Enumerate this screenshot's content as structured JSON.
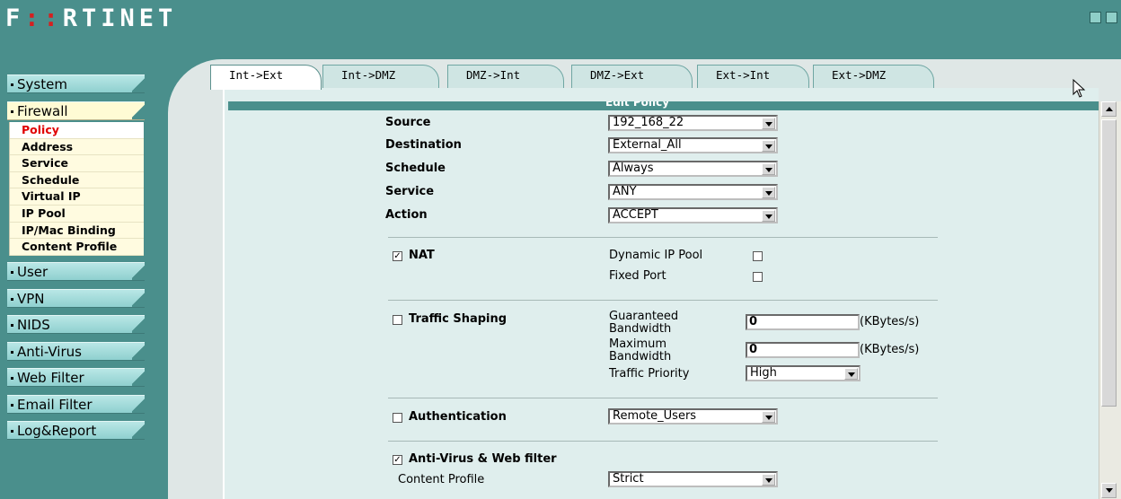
{
  "brand": {
    "logo_text_a": "F",
    "logo_text_red": "::",
    "logo_text_b": "RTINET"
  },
  "menu": [
    {
      "label": "System",
      "active": false
    },
    {
      "label": "Firewall",
      "active": true
    },
    {
      "label": "User",
      "active": false
    },
    {
      "label": "VPN",
      "active": false
    },
    {
      "label": "NIDS",
      "active": false
    },
    {
      "label": "Anti-Virus",
      "active": false
    },
    {
      "label": "Web Filter",
      "active": false
    },
    {
      "label": "Email Filter",
      "active": false
    },
    {
      "label": "Log&Report",
      "active": false
    }
  ],
  "firewall_submenu": [
    "Policy",
    "Address",
    "Service",
    "Schedule",
    "Virtual IP",
    "IP Pool",
    "IP/Mac Binding",
    "Content Profile"
  ],
  "tabs": [
    "Int->Ext",
    "Int->DMZ",
    "DMZ->Int",
    "DMZ->Ext",
    "Ext->Int",
    "Ext->DMZ"
  ],
  "panel": {
    "title": "Edit Policy"
  },
  "form": {
    "source_label": "Source",
    "source_value": "192_168_22",
    "destination_label": "Destination",
    "destination_value": "External_All",
    "schedule_label": "Schedule",
    "schedule_value": "Always",
    "service_label": "Service",
    "service_value": "ANY",
    "action_label": "Action",
    "action_value": "ACCEPT",
    "nat_label": "NAT",
    "nat_checked": true,
    "dynamic_ip_pool_label": "Dynamic IP Pool",
    "dynamic_ip_pool_checked": false,
    "fixed_port_label": "Fixed Port",
    "fixed_port_checked": false,
    "traffic_shaping_label": "Traffic Shaping",
    "traffic_shaping_checked": false,
    "guaranteed_bw_label_1": "Guaranteed",
    "guaranteed_bw_label_2": "Bandwidth",
    "guaranteed_bw_value": "0",
    "maximum_bw_label_1": "Maximum",
    "maximum_bw_label_2": "Bandwidth",
    "maximum_bw_value": "0",
    "unit": "(KBytes/s)",
    "traffic_priority_label": "Traffic Priority",
    "traffic_priority_value": "High",
    "authentication_label": "Authentication",
    "authentication_checked": false,
    "authentication_value": "Remote_Users",
    "antivirus_label": "Anti-Virus & Web filter",
    "antivirus_checked": true,
    "content_profile_label": "Content Profile",
    "content_profile_value": "Strict"
  },
  "colors": {
    "teal": "#4a8f8c",
    "menu": "#a7dcdb",
    "active_menu": "#fffbd4",
    "panel": "#dfeeed",
    "active_submenu_text": "#e00000"
  }
}
